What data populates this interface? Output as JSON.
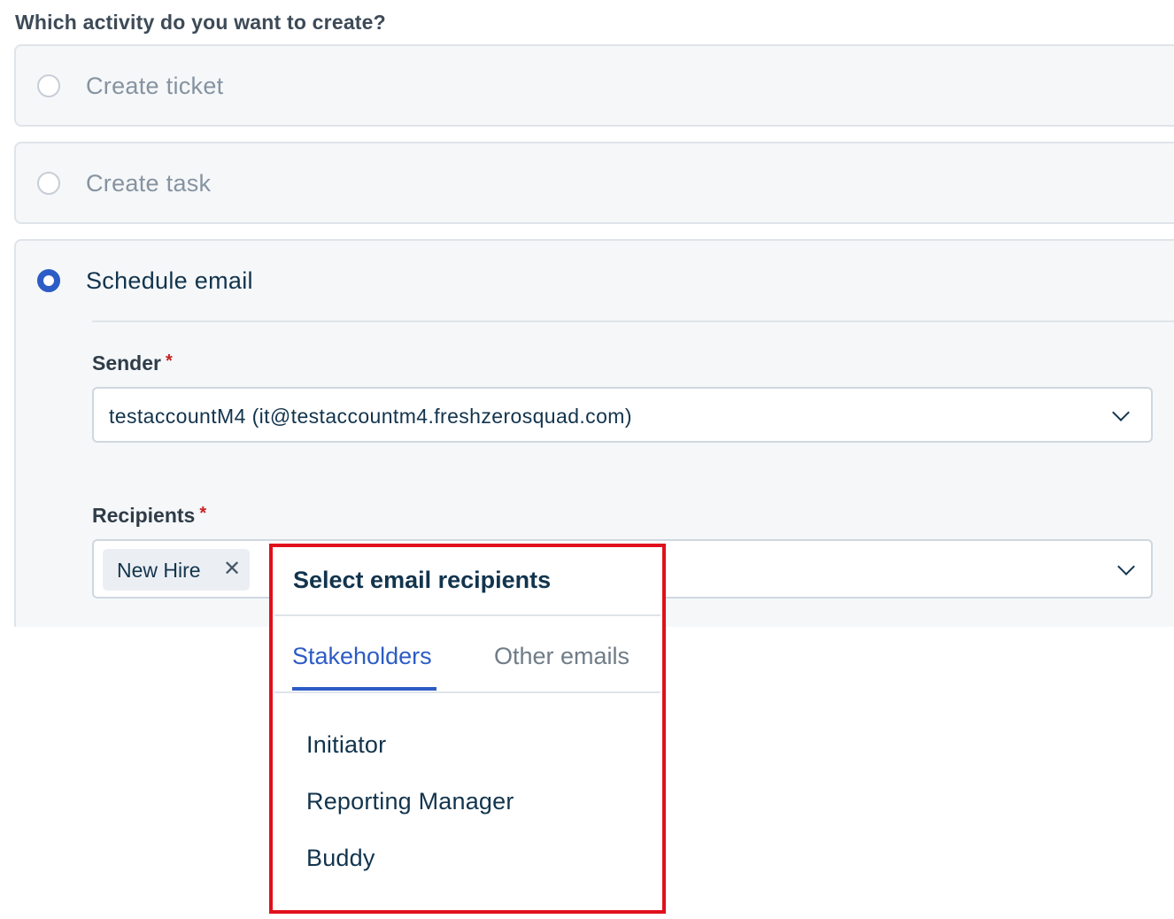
{
  "question": "Which activity do you want to create?",
  "options": [
    {
      "label": "Create ticket",
      "selected": false
    },
    {
      "label": "Create task",
      "selected": false
    },
    {
      "label": "Schedule email",
      "selected": true
    }
  ],
  "sender": {
    "label": "Sender",
    "required_mark": "*",
    "value": "testaccountM4 (it@testaccountm4.freshzerosquad.com)"
  },
  "recipients": {
    "label": "Recipients",
    "required_mark": "*",
    "chips": [
      {
        "label": "New Hire",
        "remove": "✕"
      }
    ]
  },
  "recipient_dropdown": {
    "title": "Select email recipients",
    "tabs": [
      {
        "label": "Stakeholders",
        "active": true
      },
      {
        "label": "Other emails",
        "active": false
      }
    ],
    "items": [
      "Initiator",
      "Reporting Manager",
      "Buddy"
    ]
  },
  "colors": {
    "accent": "#2c5cc5",
    "highlight_border": "#e0101c",
    "required": "#c82124"
  },
  "icons": {
    "sender_chevron": "chevron-down-icon",
    "recipients_chevron": "chevron-down-icon",
    "chip_remove": "close-icon"
  }
}
